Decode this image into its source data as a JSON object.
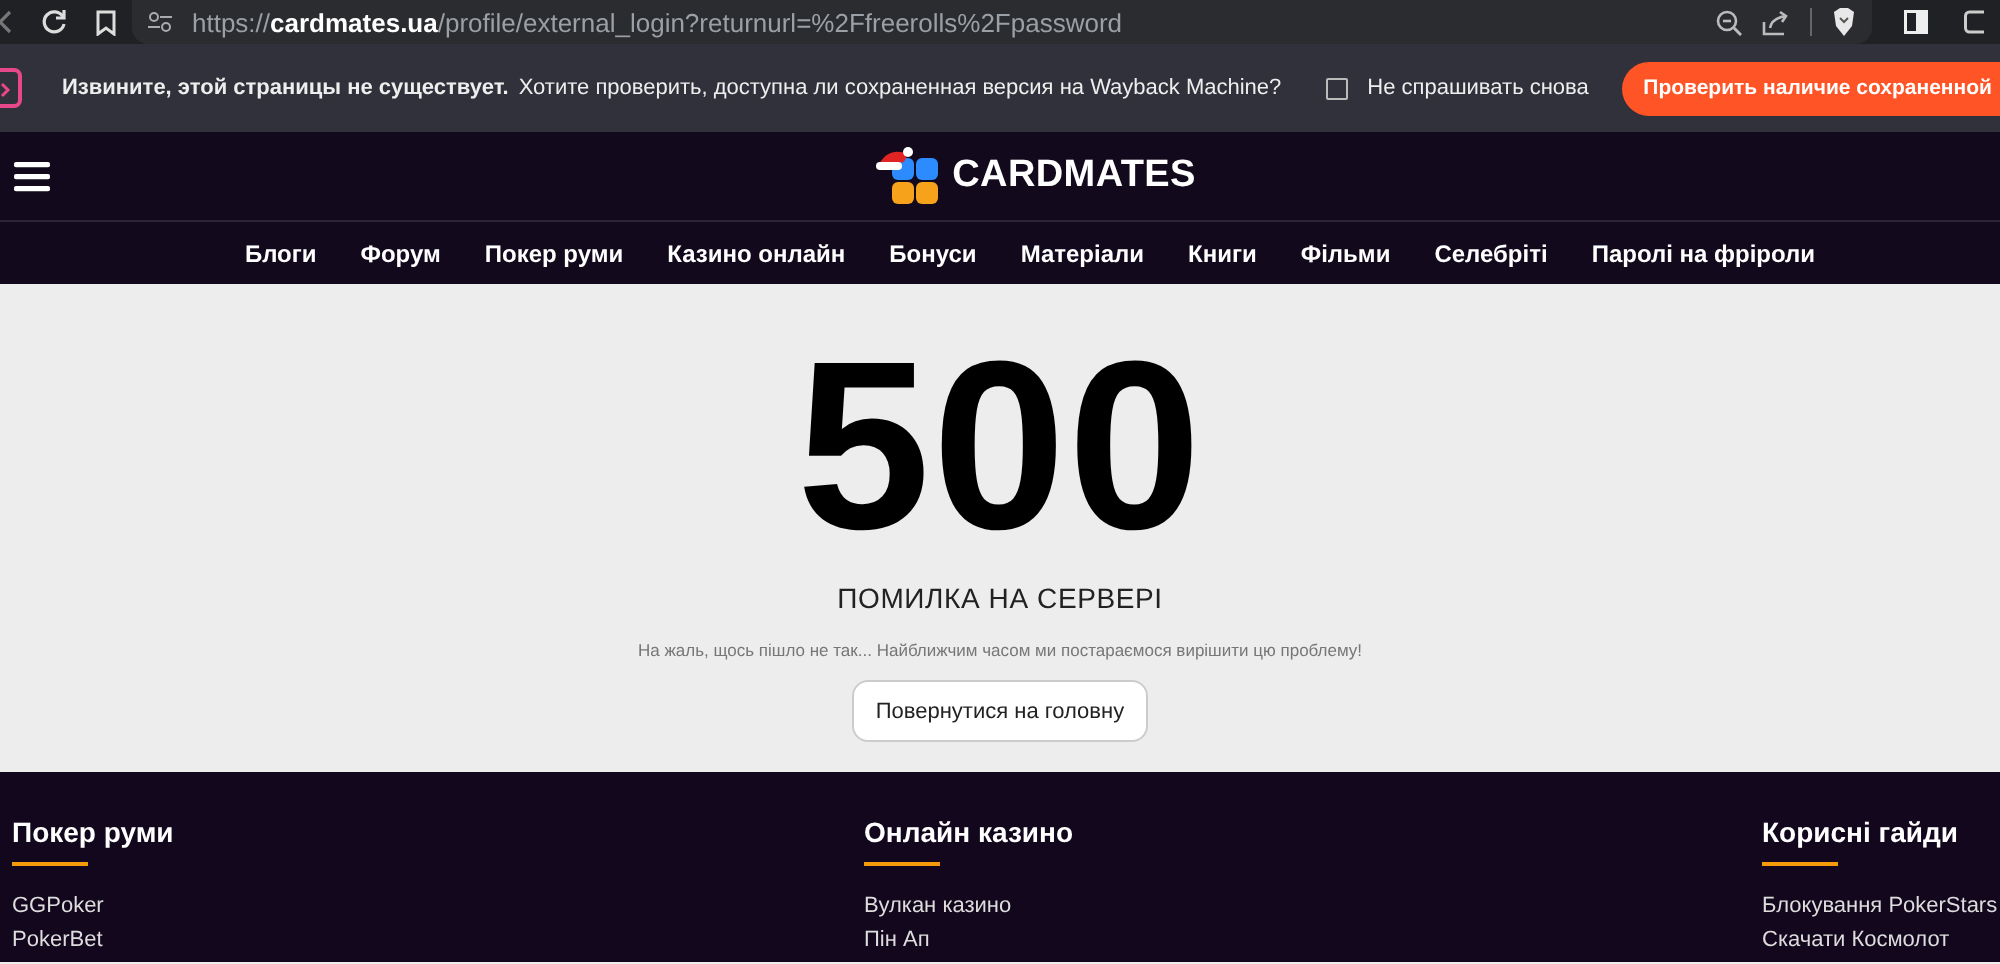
{
  "browser": {
    "url": "https://**cardmates.ua**/profile/external_login?returnurl=%2Ffreerolls%2Fpassword"
  },
  "wayback": {
    "notice": "Извините, этой страницы не существует.",
    "message": "Хотите проверить, доступна ли сохраненная версия на Wayback Machine?",
    "checkbox": {
      "label": "Не спрашивать снова",
      "checked": false
    },
    "button": "Проверить наличие сохраненной"
  },
  "header": {
    "logo_text": "CARDMATES"
  },
  "nav": [
    "Блоги",
    "Форум",
    "Покер руми",
    "Казино онлайн",
    "Бонуси",
    "Матеріали",
    "Книги",
    "Фільми",
    "Селебріті",
    "Паролі на фріроли"
  ],
  "error": {
    "code": "500",
    "title": "ПОМИЛКА НА СЕРВЕРІ",
    "message": "На жаль, щось пішло не так... Найближчим часом ми постараємося вирішити цю проблему!",
    "button": "Повернутися на головну"
  },
  "footer": {
    "columns": [
      {
        "title": "Покер руми",
        "links": [
          "GGPoker",
          "PokerBet"
        ]
      },
      {
        "title": "Онлайн казино",
        "links": [
          "Вулкан казино",
          "Пін Ап"
        ]
      },
      {
        "title": "Корисні гайди",
        "links": [
          "Блокування PokerStars",
          "Скачати Космолот"
        ]
      }
    ]
  }
}
